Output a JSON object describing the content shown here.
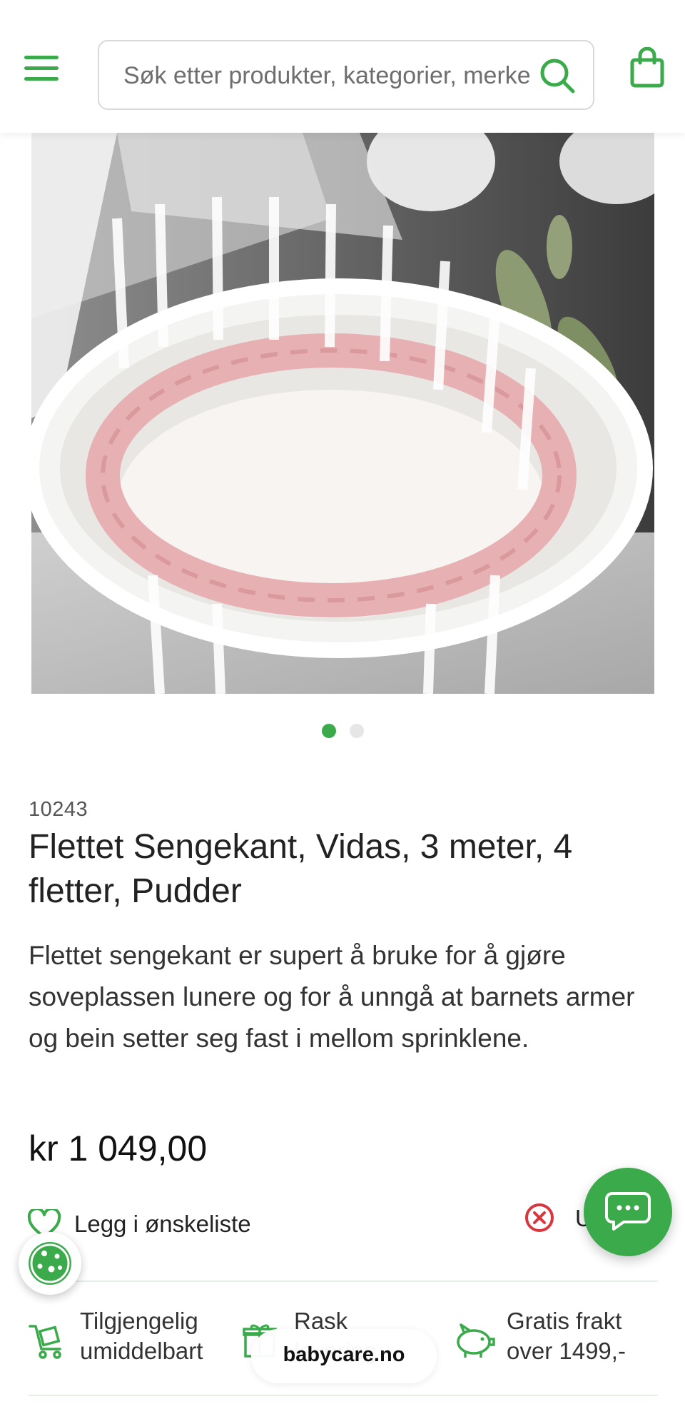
{
  "header": {
    "search_placeholder": "Søk etter produkter, kategorier, merker",
    "icons": {
      "menu": "hamburger-menu-icon",
      "search": "search-icon",
      "cart": "shopping-bag-icon"
    }
  },
  "carousel": {
    "total_slides": 2,
    "active_index": 0
  },
  "product": {
    "sku": "10243",
    "title": "Flettet Sengekant, Vidas, 3 meter, 4 fletter, Pudder",
    "description": "Flettet sengekant er supert å bruke for å gjøre soveplassen lunere og for å unngå at barnets armer og bein setter seg fast i mellom sprinklene.",
    "price": "kr 1 049,00"
  },
  "actions": {
    "wishlist_label": "Legg i ønskeliste",
    "availability_label": "U"
  },
  "usps": [
    {
      "line1": "Tilgjengelig",
      "line2": "umiddelbart",
      "icon": "cart-icon"
    },
    {
      "line1": "Rask",
      "line2": "levering",
      "icon": "gift-icon"
    },
    {
      "line1": "Gratis frakt",
      "line2": "over 1499,-",
      "icon": "piggy-bank-icon"
    }
  ],
  "browser": {
    "domain": "babycare.no"
  },
  "colors": {
    "brand_green": "#3aaa4b",
    "error_red": "#d9363e",
    "text": "#2b2b2b"
  }
}
